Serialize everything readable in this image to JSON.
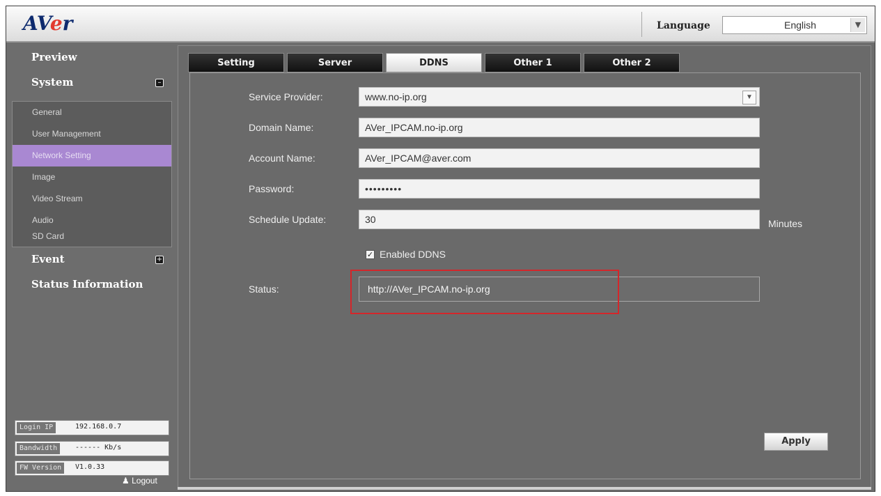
{
  "header": {
    "logo": {
      "a": "A",
      "v": "V",
      "e": "e",
      "r": "r"
    },
    "language_label": "Language",
    "language_value": "English"
  },
  "sidebar": {
    "preview": "Preview",
    "system": "System",
    "system_items": [
      {
        "label": "General"
      },
      {
        "label": "User Management"
      },
      {
        "label": "Network Setting",
        "active": true
      },
      {
        "label": "Image"
      },
      {
        "label": "Video Stream"
      },
      {
        "label": "Audio"
      },
      {
        "label": "SD Card"
      }
    ],
    "event": "Event",
    "status_information": "Status Information",
    "info": [
      {
        "label": "Login IP",
        "value": "192.168.0.7"
      },
      {
        "label": "Bandwidth",
        "value": "------ Kb/s"
      },
      {
        "label": "FW Version",
        "value": "V1.0.33"
      }
    ],
    "logout": "Logout"
  },
  "tabs": [
    {
      "label": "Setting"
    },
    {
      "label": "Server"
    },
    {
      "label": "DDNS",
      "active": true
    },
    {
      "label": "Other 1"
    },
    {
      "label": "Other 2"
    }
  ],
  "form": {
    "service_provider_label": "Service Provider:",
    "service_provider_value": "www.no-ip.org",
    "domain_name_label": "Domain Name:",
    "domain_name_value": "AVer_IPCAM.no-ip.org",
    "account_name_label": "Account Name:",
    "account_name_value": "AVer_IPCAM@aver.com",
    "password_label": "Password:",
    "password_value": "•••••••••",
    "schedule_update_label": "Schedule Update:",
    "schedule_update_value": "30",
    "minutes_label": "Minutes",
    "enabled_ddns_label": "Enabled DDNS",
    "enabled_ddns_checked": true,
    "status_label": "Status:",
    "status_value": "http://AVer_IPCAM.no-ip.org",
    "apply_label": "Apply"
  },
  "colors": {
    "brand_navy": "#0d2a6e",
    "brand_red": "#e23b2f",
    "active_item": "#a988d2",
    "highlight": "#d4262a"
  }
}
